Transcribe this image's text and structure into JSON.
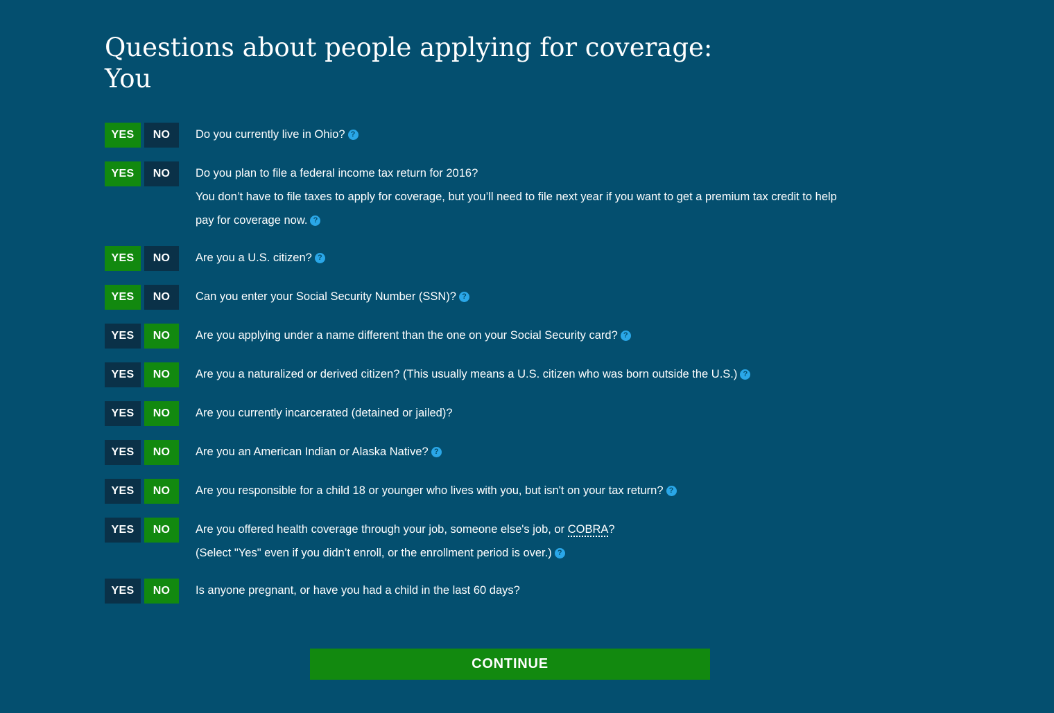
{
  "header": {
    "title_line1": "Questions about people applying for coverage:",
    "title_line2": "You"
  },
  "colors": {
    "background": "#044f6f",
    "selected": "#12890f",
    "unselected": "#0a3148",
    "help_icon": "#2aa7e8"
  },
  "labels": {
    "yes": "YES",
    "no": "NO",
    "help_icon_glyph": "?"
  },
  "questions": [
    {
      "text": "Do you currently live in Ohio?",
      "answer": "YES",
      "help": true
    },
    {
      "text": "Do you plan to file a federal income tax return for 2016?",
      "line2": "You don’t have to file taxes to apply for coverage, but you’ll need to file next year if you want to get a premium tax credit to help",
      "line3": "pay for coverage now.",
      "answer": "YES",
      "help": true
    },
    {
      "text": "Are you a U.S. citizen?",
      "answer": "YES",
      "help": true
    },
    {
      "text": "Can you enter your Social Security Number (SSN)?",
      "answer": "YES",
      "help": true
    },
    {
      "text": "Are you applying under a name different than the one on your Social Security card?",
      "answer": "NO",
      "help": true
    },
    {
      "text": "Are you a naturalized or derived citizen? (This usually means a U.S. citizen who was born outside the U.S.)",
      "answer": "NO",
      "help": true
    },
    {
      "text": "Are you currently incarcerated (detained or jailed)?",
      "answer": "NO",
      "help": false
    },
    {
      "text": "Are you an American Indian or Alaska Native?",
      "answer": "NO",
      "help": true
    },
    {
      "text": "Are you responsible for a child 18 or younger who lives with you, but isn't on your tax return?",
      "answer": "NO",
      "help": true
    },
    {
      "text": "Are you offered health coverage through your job, someone else's job, or",
      "abbr": "COBRA",
      "text_after_abbr": "?",
      "line2": "(Select \"Yes\" even if you didn’t enroll, or the enrollment period is over.)",
      "answer": "NO",
      "help": true
    },
    {
      "text": "Is anyone pregnant, or have you had a child in the last 60 days?",
      "answer": "NO",
      "help": false
    }
  ],
  "footer": {
    "continue_label": "CONTINUE"
  }
}
